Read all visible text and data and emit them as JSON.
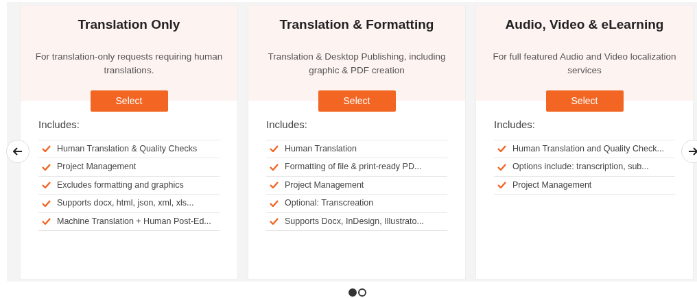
{
  "plans": [
    {
      "title": "Translation Only",
      "description": "For translation-only requests requiring human translations.",
      "button": "Select",
      "includes_label": "Includes:",
      "features": [
        "Human Translation & Quality Checks",
        "Project Management",
        "Excludes formatting and graphics",
        "Supports docx, html, json, xml, xls...",
        "Machine Translation + Human Post-Ed..."
      ]
    },
    {
      "title": "Translation & Formatting",
      "description": "Translation & Desktop Publishing, including graphic & PDF creation",
      "button": "Select",
      "includes_label": "Includes:",
      "features": [
        "Human Translation",
        "Formatting of file & print-ready PD...",
        "Project Management",
        "Optional: Transcreation",
        "Supports Docx, InDesign, Illustrato..."
      ]
    },
    {
      "title": "Audio, Video & eLearning",
      "description": "For full featured Audio and Video localization services",
      "button": "Select",
      "includes_label": "Includes:",
      "features": [
        "Human Translation and Quality Check...",
        "Options include: transcription, sub...",
        "Project Management"
      ]
    }
  ],
  "pagination": [
    {
      "selected": true
    },
    {
      "selected": false
    }
  ]
}
